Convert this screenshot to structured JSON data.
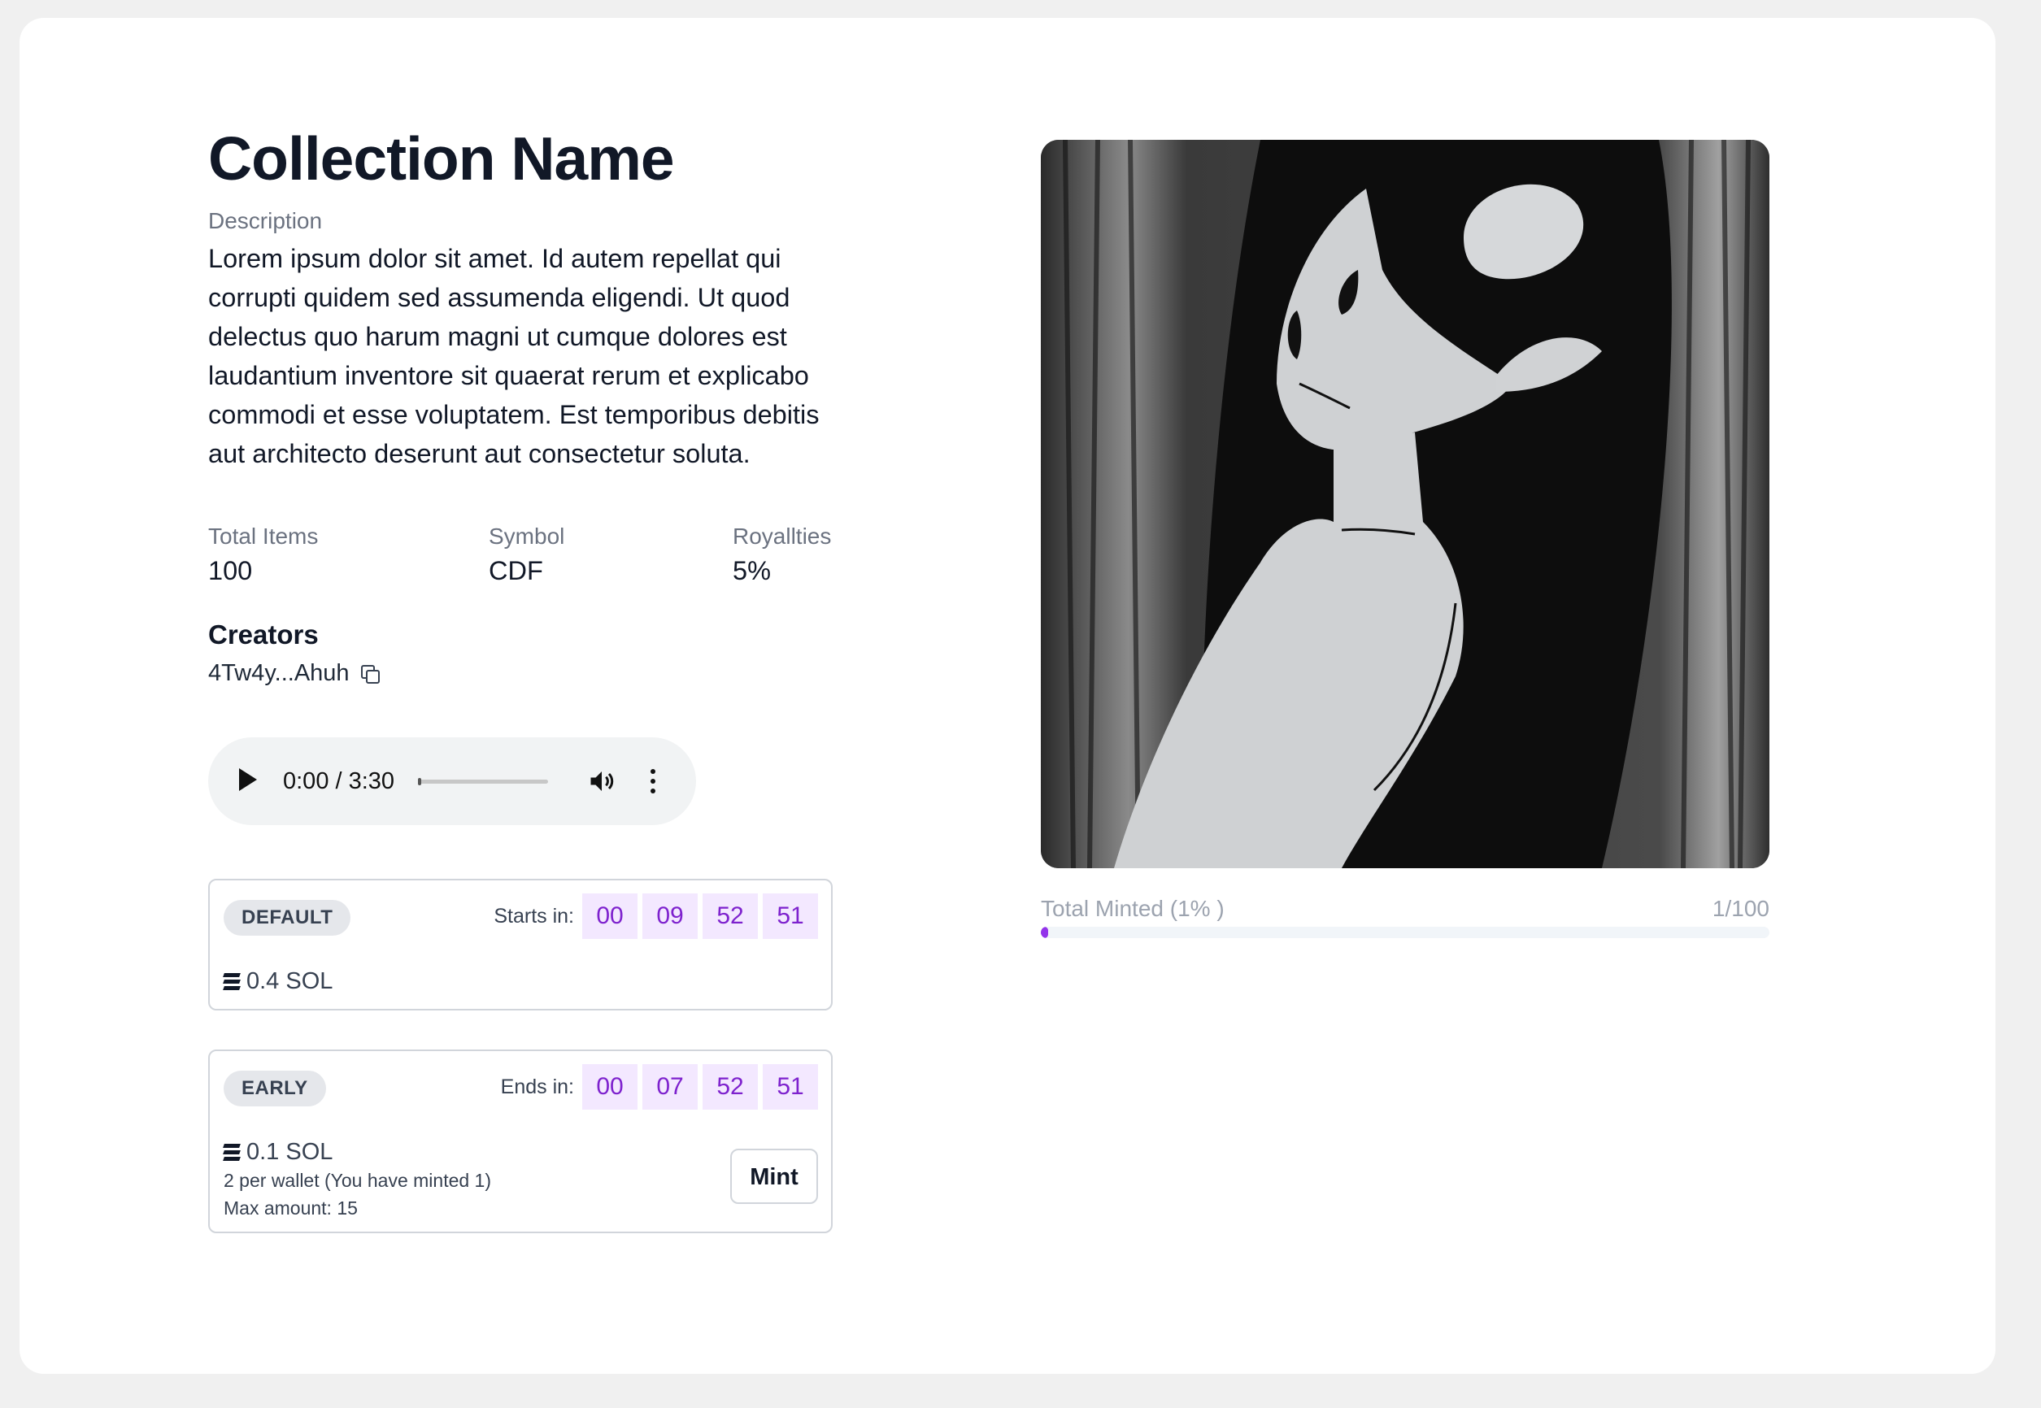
{
  "collection": {
    "title": "Collection Name",
    "description_label": "Description",
    "description": "Lorem ipsum dolor sit amet. Id autem repellat qui corrupti quidem sed assumenda eligendi. Ut quod delectus quo harum magni ut cumque dolores est laudantium inventore sit quaerat rerum et explicabo commodi et esse voluptatem. Est temporibus debitis aut architecto deserunt aut consectetur soluta."
  },
  "stats": [
    {
      "label": "Total Items",
      "value": "100"
    },
    {
      "label": "Symbol",
      "value": "CDF"
    },
    {
      "label": "Royallties",
      "value": "5%"
    }
  ],
  "creators": {
    "title": "Creators",
    "address": "4Tw4y...Ahuh"
  },
  "audio": {
    "time": "0:00 / 3:30"
  },
  "phases": [
    {
      "name": "DEFAULT",
      "countdown_label": "Starts in:",
      "countdown": [
        "00",
        "09",
        "52",
        "51"
      ],
      "price": "0.4 SOL"
    },
    {
      "name": "EARLY",
      "countdown_label": "Ends in:",
      "countdown": [
        "00",
        "07",
        "52",
        "51"
      ],
      "price": "0.1 SOL",
      "wallet_limit": "2 per wallet (You have minted 1)",
      "max_amount": "Max amount: 15",
      "mint_label": "Mint"
    }
  ],
  "minting": {
    "label": "Total Minted (1% )",
    "count": "1/100",
    "progress_fraction": 0.01
  },
  "colors": {
    "accent": "#9333ea",
    "countdown_bg": "#f3e8ff",
    "countdown_text": "#7e22ce"
  },
  "icons": {
    "copy": "copy-icon",
    "sol": "solana-icon",
    "play": "play-icon",
    "volume": "volume-icon",
    "more": "more-vertical-icon"
  }
}
